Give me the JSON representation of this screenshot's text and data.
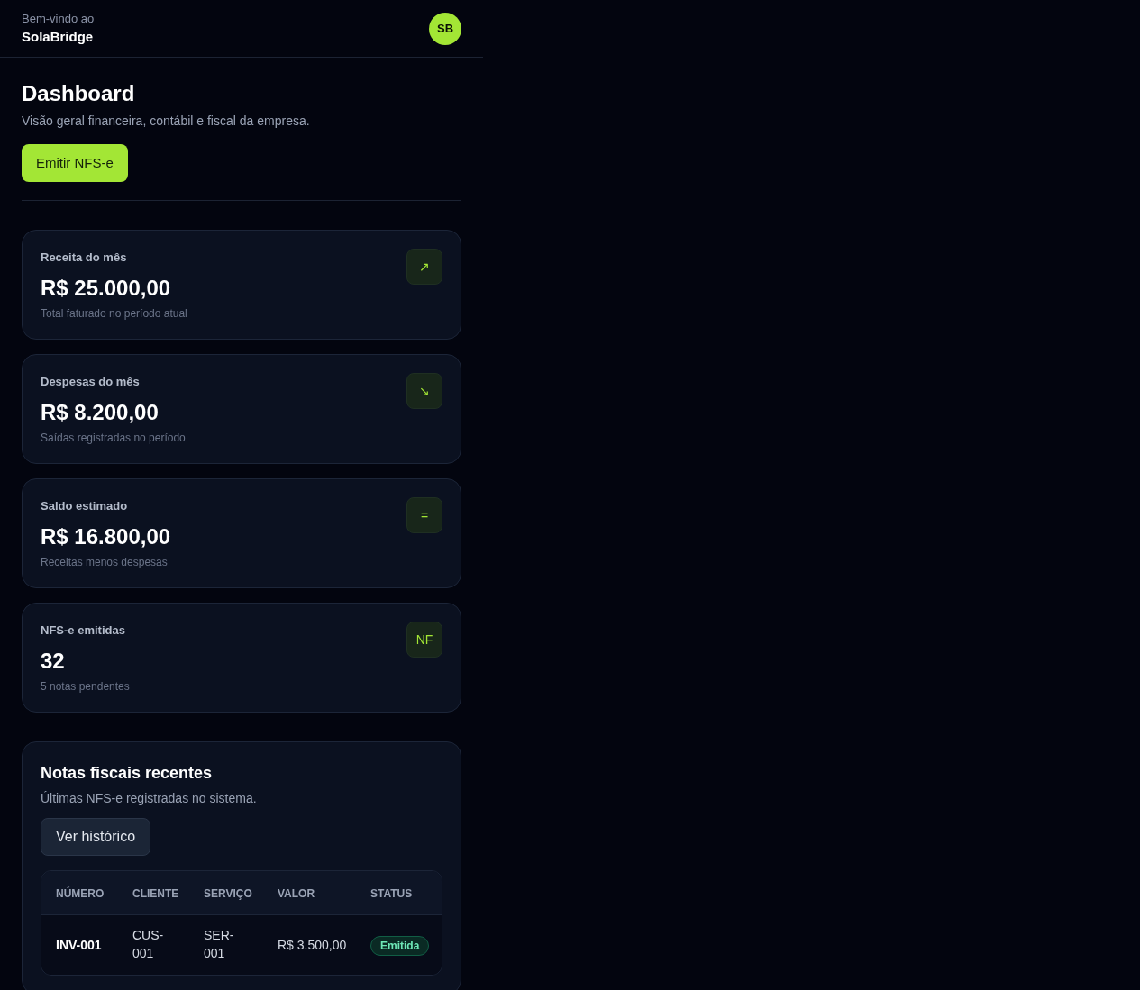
{
  "header": {
    "greeting": "Bem-vindo ao",
    "brand": "SolaBridge",
    "avatar": "SB"
  },
  "page": {
    "title": "Dashboard",
    "subtitle": "Visão geral financeira, contábil e fiscal da empresa.",
    "action": "Emitir NFS-e"
  },
  "stats": [
    {
      "label": "Receita do mês",
      "value": "R$ 25.000,00",
      "note": "Total faturado no período atual",
      "icon": "↗"
    },
    {
      "label": "Despesas do mês",
      "value": "R$ 8.200,00",
      "note": "Saídas registradas no período",
      "icon": "↘"
    },
    {
      "label": "Saldo estimado",
      "value": "R$ 16.800,00",
      "note": "Receitas menos despesas",
      "icon": "="
    },
    {
      "label": "NFS-e emitidas",
      "value": "32",
      "note": "5 notas pendentes",
      "icon": "NF"
    }
  ],
  "recent": {
    "title": "Notas fiscais recentes",
    "subtitle": "Últimas NFS-e registradas no sistema.",
    "button": "Ver histórico",
    "table": {
      "columns": [
        "NÚMERO",
        "CLIENTE",
        "SERVIÇO",
        "VALOR",
        "STATUS"
      ],
      "rows": [
        {
          "number": "INV-001",
          "client": "CUS-001",
          "service": "SER-001",
          "value": "R$ 3.500,00",
          "status": "Emitida"
        }
      ]
    }
  }
}
